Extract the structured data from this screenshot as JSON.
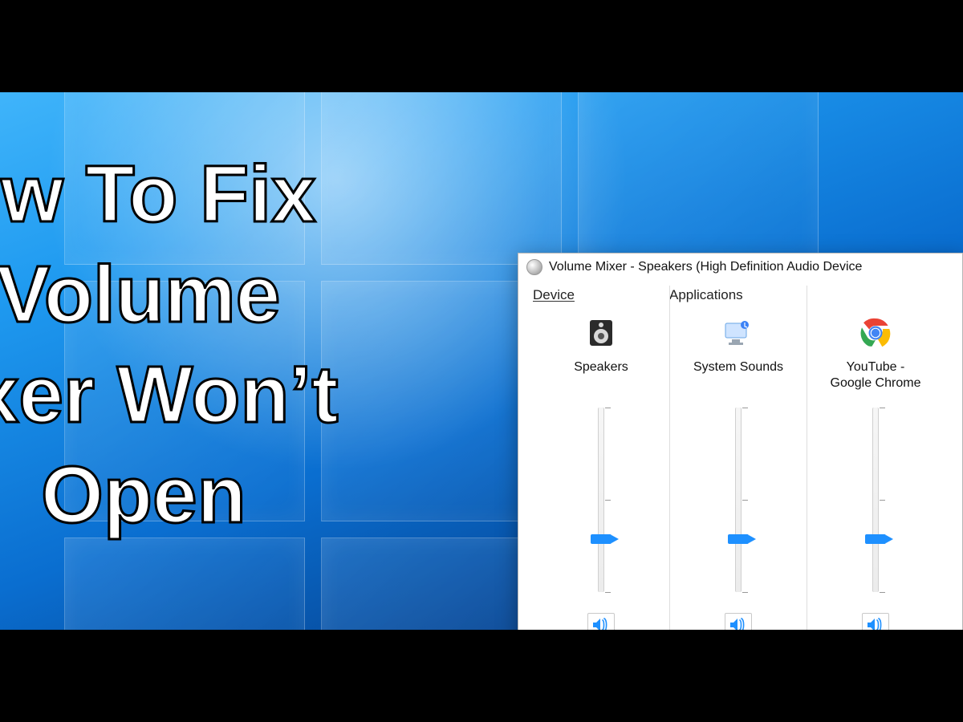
{
  "headline": {
    "line1": "ow To Fix",
    "line2": "Volume",
    "line3": "ixer Won’t",
    "line4": "Open"
  },
  "mixer": {
    "title": "Volume Mixer - Speakers (High Definition Audio Device",
    "sectionDevice": "Device",
    "sectionApps": "Applications",
    "columns": [
      {
        "id": "speakers",
        "label": "Speakers",
        "level": 28,
        "icon": "speaker-device"
      },
      {
        "id": "system",
        "label": "System Sounds",
        "level": 28,
        "icon": "system-sounds"
      },
      {
        "id": "chrome",
        "label": "YouTube -\nGoogle Chrome",
        "level": 28,
        "icon": "chrome"
      }
    ]
  }
}
